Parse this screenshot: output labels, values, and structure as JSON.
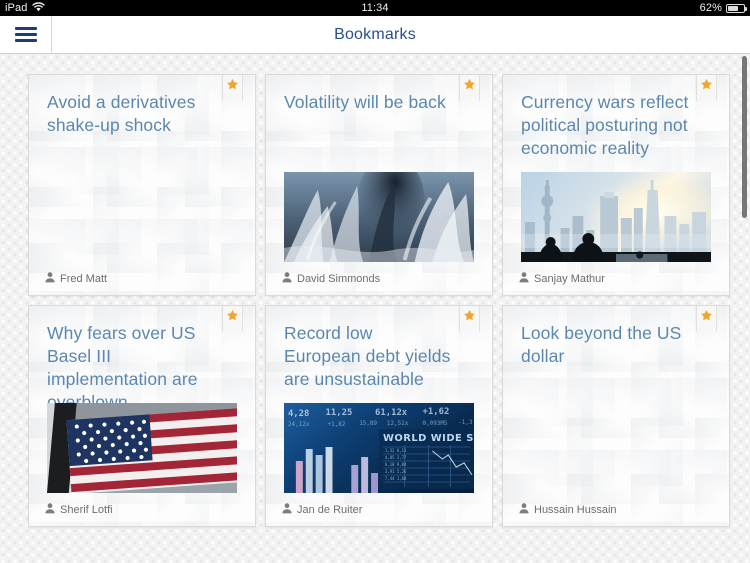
{
  "status_bar": {
    "carrier": "iPad",
    "wifi_icon": "wifi-icon",
    "time": "11:34",
    "battery_percent": "62%",
    "battery_level": 60,
    "battery_icon": "battery-icon"
  },
  "nav_bar": {
    "menu_icon": "hamburger-menu-icon",
    "title": "Bookmarks",
    "title_color": "#2a4f8f"
  },
  "theme": {
    "title_color": "#5b87ae",
    "star_color": "#f0a52e",
    "byline_color": "#6d6d6d",
    "page_background": "#f2f2f2",
    "card_background": "#fdfdfd"
  },
  "scrollbar": {
    "visible": true,
    "position": "right"
  },
  "cards": [
    {
      "title": "Avoid a derivatives shake-up shock",
      "author": "Fred Matt",
      "bookmarked": true,
      "star_icon": "star-icon",
      "author_icon": "person-icon",
      "has_thumbnail": false,
      "thumbnail_alt": ""
    },
    {
      "title": "Volatility will be back",
      "author": "David Simmonds",
      "bookmarked": true,
      "star_icon": "star-icon",
      "author_icon": "person-icon",
      "has_thumbnail": true,
      "thumbnail_alt": "crashing ocean waves and sea spray"
    },
    {
      "title": "Currency wars reflect political posturing not economic reality",
      "author": "Sanjay Mathur",
      "bookmarked": true,
      "star_icon": "star-icon",
      "author_icon": "person-icon",
      "has_thumbnail": true,
      "thumbnail_alt": "hazy Shanghai skyline at sunset with silhouetted figures"
    },
    {
      "title": "Why fears over US Basel III implementation are overblown",
      "author": "Sherif Lotfi",
      "bookmarked": true,
      "star_icon": "star-icon",
      "author_icon": "person-icon",
      "has_thumbnail": true,
      "thumbnail_alt": "United States stars and stripes flag"
    },
    {
      "title": "Record low European debt yields are unsustainable",
      "author": "Jan de Ruiter",
      "bookmarked": true,
      "star_icon": "star-icon",
      "author_icon": "person-icon",
      "has_thumbnail": true,
      "thumbnail_alt": "blue financial stock ticker board reading WORLD WIDE STOCK with bar chart"
    },
    {
      "title": "Look beyond the US dollar",
      "author": "Hussain Hussain",
      "bookmarked": true,
      "star_icon": "star-icon",
      "author_icon": "person-icon",
      "has_thumbnail": false,
      "thumbnail_alt": ""
    }
  ]
}
